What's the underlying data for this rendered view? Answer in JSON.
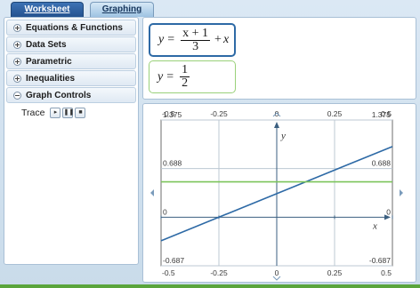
{
  "tabs": [
    {
      "label": "Worksheet",
      "active": true
    },
    {
      "label": "Graphing",
      "active": false
    }
  ],
  "sidebar": {
    "sections": [
      {
        "label": "Equations & Functions",
        "expanded": false
      },
      {
        "label": "Data Sets",
        "expanded": false
      },
      {
        "label": "Parametric",
        "expanded": false
      },
      {
        "label": "Inequalities",
        "expanded": false
      },
      {
        "label": "Graph Controls",
        "expanded": true
      }
    ],
    "trace": {
      "label": "Trace",
      "buttons": [
        "play",
        "pause",
        "stop"
      ]
    }
  },
  "expressions": [
    {
      "lhs": "y",
      "eq": "=",
      "num": "x + 1",
      "den": "3",
      "op": "+",
      "tail": "x",
      "color": "#2e6aa6"
    },
    {
      "lhs": "y",
      "eq": "=",
      "num": "1",
      "den": "2",
      "color": "#9ad17a"
    }
  ],
  "chart_data": {
    "type": "line",
    "xlim": [
      -0.5,
      0.5
    ],
    "ylim": [
      -0.687,
      1.375
    ],
    "x_ticks": [
      "-0.5",
      "-0.25",
      "0",
      "0.25",
      "0.5"
    ],
    "y_ticks_left": [
      "1.375",
      "0.688",
      "0",
      "-0.687"
    ],
    "y_ticks_right": [
      "1.375",
      "0.688",
      "0",
      "-0.687"
    ],
    "xlabel": "x",
    "ylabel": "y",
    "grid": true,
    "series": [
      {
        "formula": "y = (x+1)/3 + x",
        "x": [
          -0.5,
          0.5
        ],
        "y": [
          -0.333,
          1.0
        ],
        "color": "#2e6aa6"
      },
      {
        "formula": "y = 1/2",
        "x": [
          -0.5,
          0.5
        ],
        "y": [
          0.5,
          0.5
        ],
        "color": "#7cc45a"
      }
    ]
  }
}
